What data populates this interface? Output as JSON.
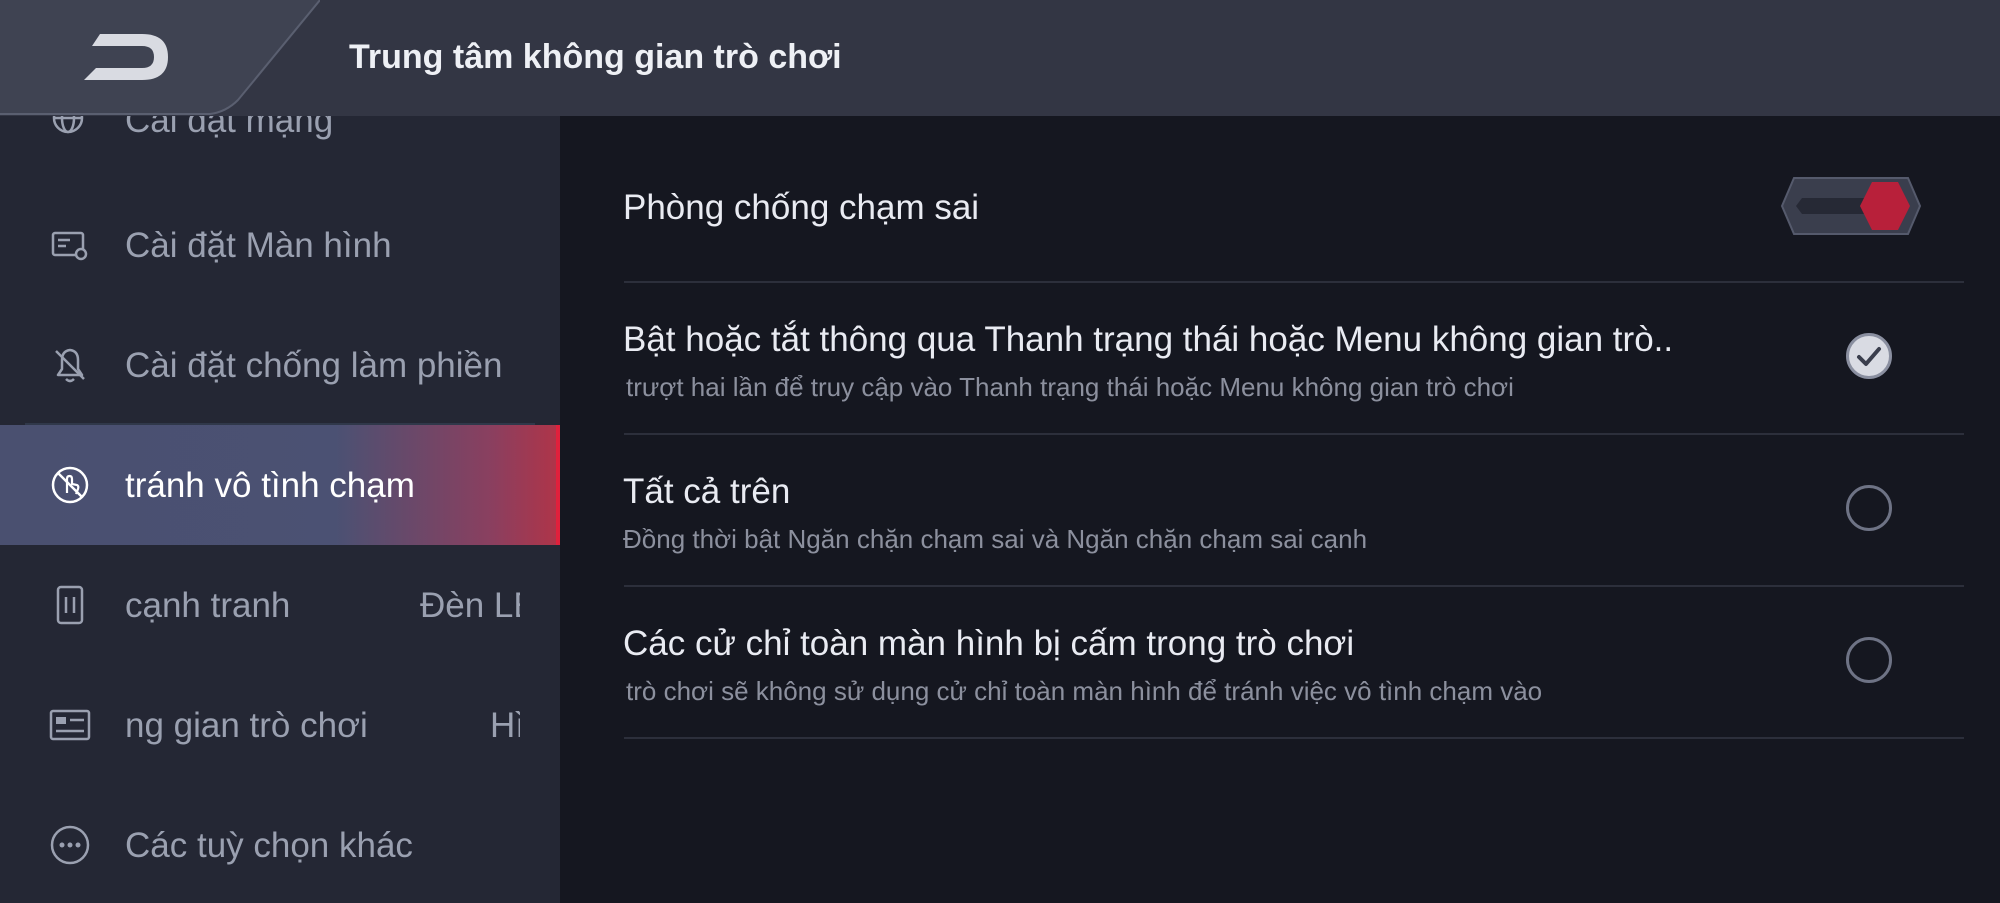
{
  "header": {
    "title": "Trung tâm không gian trò chơi",
    "back_icon": "back-arrow-icon"
  },
  "sidebar": {
    "items": [
      {
        "label": "Cài đặt mạng",
        "icon": "network-globe-icon"
      },
      {
        "label": "Cài đặt Màn hình",
        "icon": "display-settings-icon"
      },
      {
        "label": "Cài đặt chống làm phiền",
        "icon": "bell-off-icon"
      },
      {
        "label": "tránh vô tình chạm",
        "icon": "no-touch-icon",
        "active": true
      },
      {
        "label": "cạnh tranh",
        "value": "Đèn LE",
        "icon": "edge-vibration-icon"
      },
      {
        "label": "ng gian trò chơi",
        "value": "Hì",
        "icon": "game-window-icon"
      },
      {
        "label": "Các tuỳ chọn khác",
        "icon": "more-options-icon"
      }
    ]
  },
  "main": {
    "toggle_row": {
      "title": "Phòng chống chạm sai",
      "enabled": true
    },
    "options": [
      {
        "title": "Bật hoặc tắt thông qua Thanh trạng thái hoặc Menu không gian trò..",
        "subtitle": "trượt hai lần để truy cập vào Thanh trạng thái hoặc Menu không gian trò chơi",
        "selected": true
      },
      {
        "title": "Tất cả trên",
        "subtitle": "Đồng thời bật Ngăn chặn chạm sai và Ngăn chặn chạm sai cạnh",
        "selected": false
      },
      {
        "title": "Các cử chỉ toàn màn hình bị cấm trong trò chơi",
        "subtitle": "trò chơi sẽ không sử dụng cử chỉ toàn màn hình để tránh việc vô tình chạm vào",
        "selected": false
      }
    ]
  },
  "colors": {
    "accent": "#c0223a",
    "active_gradient_start": "#4a5070",
    "active_gradient_end": "#b03448"
  }
}
